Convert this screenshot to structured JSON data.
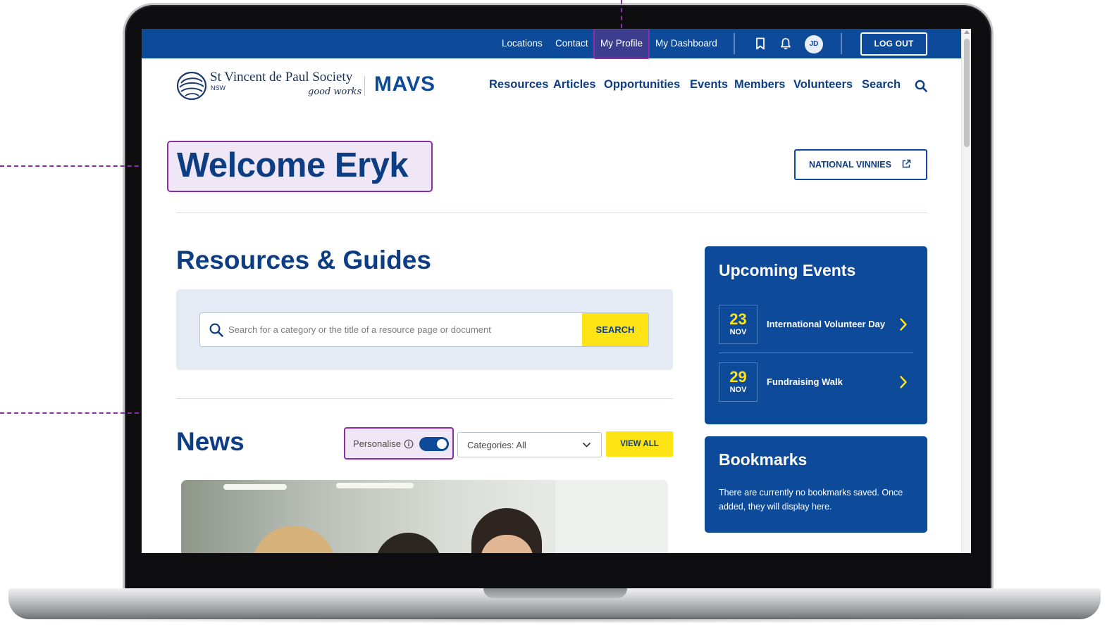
{
  "utility_nav": {
    "locations": "Locations",
    "contact": "Contact",
    "my_profile": "My Profile",
    "my_dashboard": "My Dashboard",
    "avatar_initials": "JD",
    "logout": "LOG OUT"
  },
  "logo": {
    "name": "St Vincent de Paul Society",
    "state": "NSW",
    "tagline": "good works",
    "product": "MAVS"
  },
  "main_nav": {
    "items": [
      "Resources",
      "Articles",
      "Opportunities",
      "Events",
      "Members",
      "Volunteers",
      "Search"
    ]
  },
  "welcome": {
    "heading": "Welcome Eryk",
    "national_button": "NATIONAL VINNIES"
  },
  "resources": {
    "title": "Resources & Guides",
    "search_placeholder": "Search for a category or the title of a resource page or document",
    "search_button": "SEARCH"
  },
  "news": {
    "title": "News",
    "personalise_label": "Personalise",
    "personalise_on": true,
    "categories_label": "Categories: All",
    "view_all": "VIEW ALL"
  },
  "upcoming_events": {
    "title": "Upcoming Events",
    "items": [
      {
        "day": "23",
        "month": "NOV",
        "name": "International Volunteer Day"
      },
      {
        "day": "29",
        "month": "NOV",
        "name": "Fundraising Walk"
      }
    ]
  },
  "bookmarks": {
    "title": "Bookmarks",
    "empty_text": "There are currently no bookmarks saved. Once added, they will display here."
  },
  "colors": {
    "brand_blue": "#0d4a99",
    "accent_yellow": "#ffe415",
    "annotation_purple": "#8a2da8"
  },
  "icons": [
    "bookmark-icon",
    "bell-icon",
    "search-icon",
    "external-link-icon",
    "info-icon",
    "chevron-down-icon",
    "chevron-right-icon"
  ]
}
